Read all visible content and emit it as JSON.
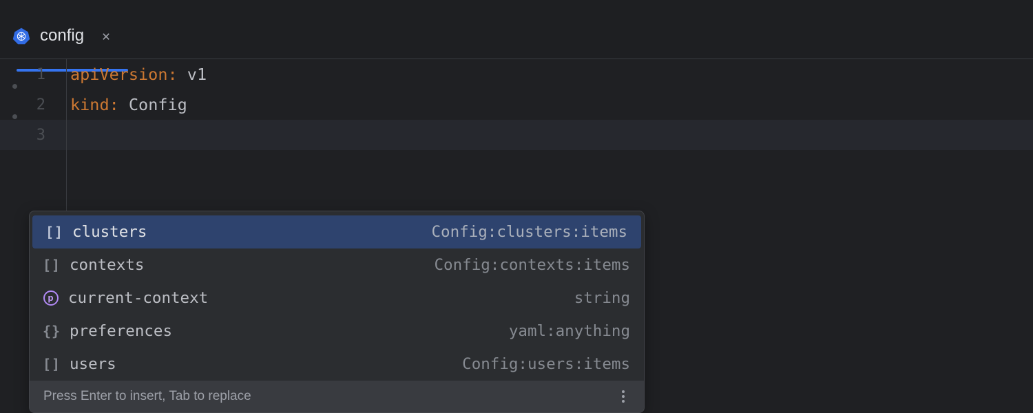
{
  "tab": {
    "title": "config"
  },
  "gutter": {
    "lines": [
      "1",
      "2",
      "3"
    ]
  },
  "code": {
    "line1_key": "apiVersion",
    "line1_val": "v1",
    "line2_key": "kind",
    "line2_val": "Config"
  },
  "completion": {
    "items": [
      {
        "label": "clusters",
        "type": "Config:clusters:items",
        "icon": "brackets",
        "selected": true
      },
      {
        "label": "contexts",
        "type": "Config:contexts:items",
        "icon": "brackets",
        "selected": false
      },
      {
        "label": "current-context",
        "type": "string",
        "icon": "purple-p",
        "selected": false
      },
      {
        "label": "preferences",
        "type": "yaml:anything",
        "icon": "braces",
        "selected": false
      },
      {
        "label": "users",
        "type": "Config:users:items",
        "icon": "brackets",
        "selected": false
      }
    ],
    "footer_hint": "Press Enter to insert, Tab to replace"
  }
}
